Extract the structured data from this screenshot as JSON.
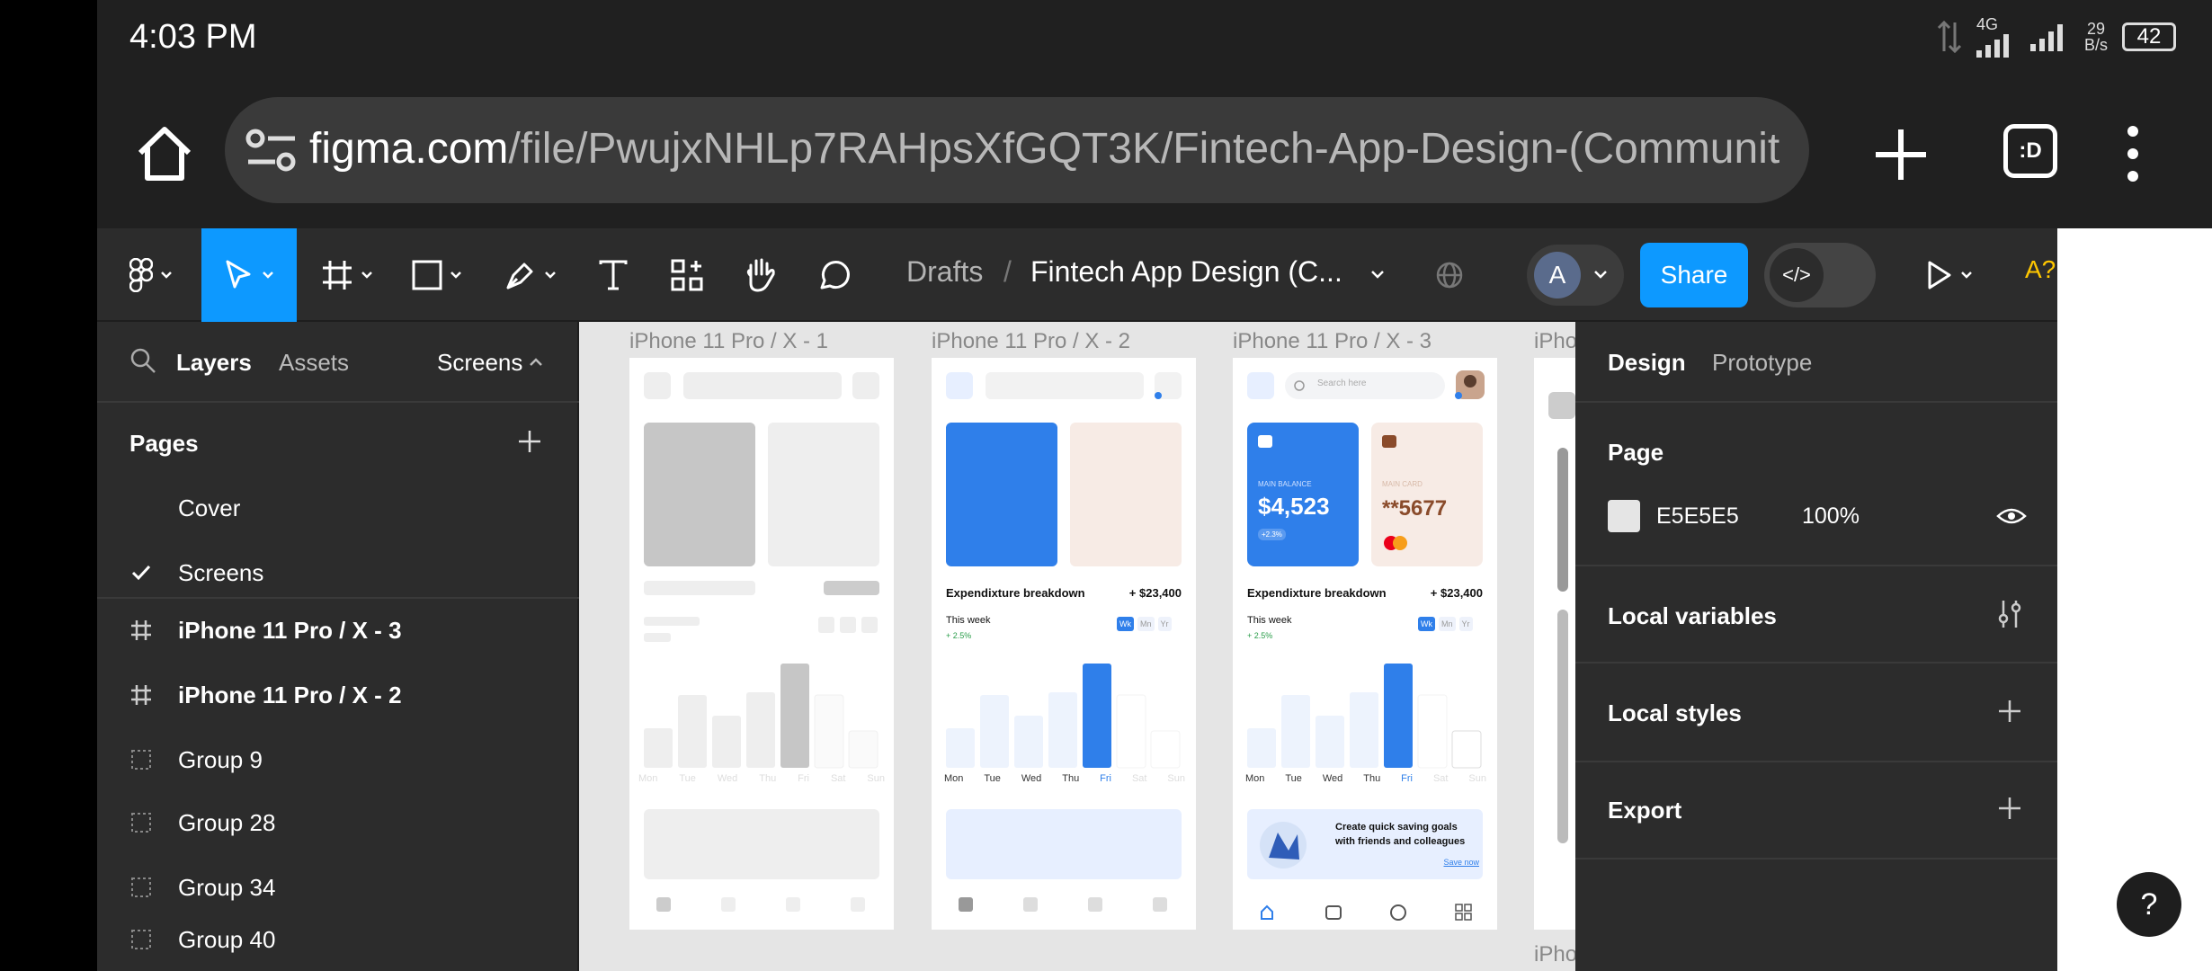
{
  "status": {
    "time": "4:03 PM",
    "network": "4G",
    "speed_value": "29",
    "speed_unit": "B/s",
    "battery": "42"
  },
  "browser": {
    "url_domain": "figma.com",
    "url_path": "/file/PwujxNHLp7RAHpsXfGQT3K/Fintech-App-Design-(Communit",
    "tabs_label": ":D"
  },
  "toolbar": {
    "breadcrumb_drafts": "Drafts",
    "breadcrumb_separator": "/",
    "file_name": "Fintech App Design (C...",
    "avatar_initial": "A",
    "share_label": "Share",
    "dev_mode_label": "</>",
    "a11y_label": "A?"
  },
  "left_panel": {
    "tabs": [
      "Layers",
      "Assets"
    ],
    "page_selector": "Screens",
    "pages_heading": "Pages",
    "pages": [
      {
        "label": "Cover",
        "selected": false
      },
      {
        "label": "Screens",
        "selected": true
      }
    ],
    "layers": [
      {
        "label": "iPhone 11 Pro / X - 3",
        "type": "frame"
      },
      {
        "label": "iPhone 11 Pro / X - 2",
        "type": "frame"
      },
      {
        "label": "Group 9",
        "type": "group"
      },
      {
        "label": "Group 28",
        "type": "group"
      },
      {
        "label": "Group 34",
        "type": "group"
      },
      {
        "label": "Group 40",
        "type": "group"
      }
    ]
  },
  "canvas": {
    "frames": [
      {
        "label": "iPhone 11 Pro / X - 1"
      },
      {
        "label": "iPhone 11 Pro / X - 2"
      },
      {
        "label": "iPhone 11 Pro / X - 3"
      },
      {
        "label": "iPho"
      }
    ],
    "bottom_cut_label": "iPho",
    "screen3": {
      "search_placeholder": "Search here",
      "card1_label": "MAIN BALANCE",
      "card1_value": "$4,523",
      "card1_change": "+2.3%",
      "card2_label": "MAIN CARD",
      "card2_value": "**5677",
      "breakdown_title": "Expendixture breakdown",
      "breakdown_value": "+ $23,400",
      "week_label": "This week",
      "week_change": "+ 2.5%",
      "toggle": [
        "Wk",
        "Mn",
        "Yr"
      ],
      "days": [
        "Mon",
        "Tue",
        "Wed",
        "Thu",
        "Fri",
        "Sat",
        "Sun"
      ],
      "bar_levels": [
        0.38,
        0.7,
        0.5,
        0.72,
        1.0,
        0.7,
        0.35
      ],
      "promo_text_1": "Create quick saving goals",
      "promo_text_2": "with friends and colleagues",
      "promo_link": "Save now"
    },
    "screen2": {
      "breakdown_title": "Expendixture breakdown",
      "breakdown_value": "+ $23,400",
      "week_label": "This week",
      "week_change": "+ 2.5%",
      "toggle": [
        "Wk",
        "Mn",
        "Yr"
      ],
      "days": [
        "Mon",
        "Tue",
        "Wed",
        "Thu",
        "Fri",
        "Sat",
        "Sun"
      ]
    },
    "screen1": {
      "days": [
        "Mon",
        "Tue",
        "Wed",
        "Thu",
        "Fri",
        "Sat",
        "Sun"
      ]
    }
  },
  "right_panel": {
    "tabs": [
      "Design",
      "Prototype"
    ],
    "page_heading": "Page",
    "bg_hex": "E5E5E5",
    "bg_opacity": "100%",
    "local_variables": "Local variables",
    "local_styles": "Local styles",
    "export": "Export"
  },
  "help_label": "?",
  "colors": {
    "accent": "#0d99ff",
    "chart_blue": "#2f7fea",
    "panel_bg": "#2c2c2c",
    "canvas_bg": "#e5e5e5"
  }
}
